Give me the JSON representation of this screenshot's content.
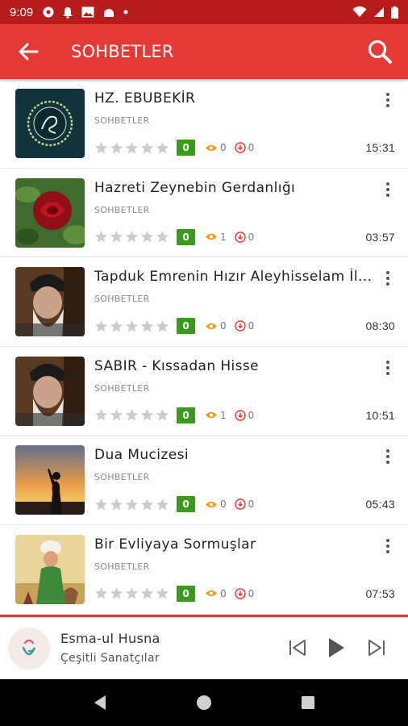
{
  "status_bar": {
    "time": "9:09",
    "icons": [
      "chrome-icon",
      "notification-bell-icon",
      "image-icon",
      "android-icon",
      "dot-icon",
      "wifi-icon",
      "signal-icon",
      "battery-icon"
    ]
  },
  "app_bar": {
    "title": "SOHBETLER",
    "back_icon": "arrow-left-icon",
    "search_icon": "search-icon"
  },
  "colors": {
    "status_bar": "#b71c1c",
    "app_bar": "#e53935",
    "badge": "#3a9a1a",
    "views_icon": "#f29b21",
    "download_icon": "#e53935",
    "star": "#cccccc"
  },
  "items": [
    {
      "title": "HZ. EBUBEKİR",
      "category": "SOHBETLER",
      "rating": 0,
      "rating_badge": "0",
      "views": "0",
      "downloads": "0",
      "duration": "15:31"
    },
    {
      "title": "Hazreti Zeynebin Gerdanlığı",
      "category": "SOHBETLER",
      "rating": 0,
      "rating_badge": "0",
      "views": "1",
      "downloads": "0",
      "duration": "03:57"
    },
    {
      "title": "Tapduk Emrenin Hızır Aleyhisselam İl...",
      "category": "SOHBETLER",
      "rating": 0,
      "rating_badge": "0",
      "views": "0",
      "downloads": "0",
      "duration": "08:30"
    },
    {
      "title": "SABIR - Kıssadan Hisse",
      "category": "SOHBETLER",
      "rating": 0,
      "rating_badge": "0",
      "views": "1",
      "downloads": "0",
      "duration": "10:51"
    },
    {
      "title": "Dua Mucizesi",
      "category": "SOHBETLER",
      "rating": 0,
      "rating_badge": "0",
      "views": "0",
      "downloads": "0",
      "duration": "05:43"
    },
    {
      "title": "Bir Evliyaya Sormuşlar",
      "category": "SOHBETLER",
      "rating": 0,
      "rating_badge": "0",
      "views": "0",
      "downloads": "0",
      "duration": "07:53"
    }
  ],
  "player": {
    "title": "Esma-ul Husna",
    "artist": "Çeşitli Sanatçılar"
  }
}
